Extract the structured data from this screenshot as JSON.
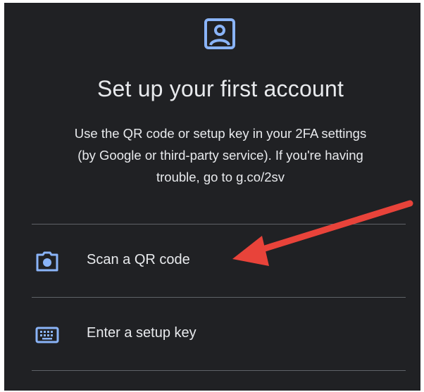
{
  "colors": {
    "background": "#202124",
    "text": "#e8eaed",
    "accent": "#8ab4f8",
    "divider": "#5f6368",
    "annotation_arrow": "#e8433a"
  },
  "header": {
    "icon": "account-box-icon",
    "title": "Set up your first account"
  },
  "description": {
    "line1": "Use the QR code or setup key in your 2FA settings",
    "line2": "(by Google or third-party service). If you're having",
    "line3": "trouble, go to g.co/2sv"
  },
  "options": [
    {
      "icon": "camera-icon",
      "label": "Scan a QR code"
    },
    {
      "icon": "keyboard-icon",
      "label": "Enter a setup key"
    }
  ]
}
